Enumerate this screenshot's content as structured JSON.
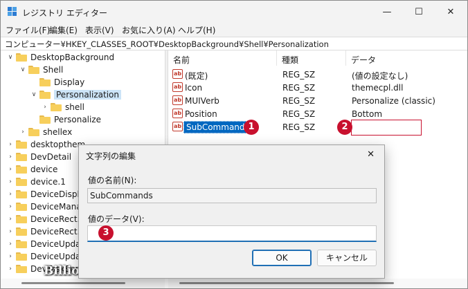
{
  "window": {
    "title": "レジストリ エディター",
    "controls": {
      "minimize": "—",
      "maximize": "☐",
      "close": "✕"
    }
  },
  "menu": [
    "ファイル(F)",
    "編集(E)",
    "表示(V)",
    "お気に入り(A)",
    "ヘルプ(H)"
  ],
  "address": "コンピューター¥HKEY_CLASSES_ROOT¥DesktopBackground¥Shell¥Personalization",
  "tree": [
    {
      "label": "DesktopBackground",
      "arrow": "∨"
    },
    {
      "label": "Shell",
      "arrow": "∨"
    },
    {
      "label": "Display",
      "arrow": ""
    },
    {
      "label": "Personalization",
      "arrow": "∨",
      "selected": true
    },
    {
      "label": "shell",
      "arrow": "›"
    },
    {
      "label": "Personalize",
      "arrow": ""
    },
    {
      "label": "shellex",
      "arrow": "›"
    },
    {
      "label": "desktopthem…",
      "arrow": "›"
    },
    {
      "label": "DevDetail",
      "arrow": "›"
    },
    {
      "label": "device",
      "arrow": "›"
    },
    {
      "label": "device.1",
      "arrow": "›"
    },
    {
      "label": "DeviceDispla…",
      "arrow": "›"
    },
    {
      "label": "DeviceManag…",
      "arrow": "›"
    },
    {
      "label": "DeviceRect.D…",
      "arrow": "›"
    },
    {
      "label": "DeviceRect.D…",
      "arrow": "›"
    },
    {
      "label": "DeviceUpdat…",
      "arrow": "›"
    },
    {
      "label": "DeviceUpdat…",
      "arrow": "›"
    },
    {
      "label": "DevTaskSer…",
      "arrow": "›"
    }
  ],
  "list": {
    "headers": {
      "name": "名前",
      "type": "種類",
      "data": "データ"
    },
    "rows": [
      {
        "name": "(既定)",
        "type": "REG_SZ",
        "data": "(値の設定なし)"
      },
      {
        "name": "Icon",
        "type": "REG_SZ",
        "data": "themecpl.dll"
      },
      {
        "name": "MUIVerb",
        "type": "REG_SZ",
        "data": "Personalize (classic)"
      },
      {
        "name": "Position",
        "type": "REG_SZ",
        "data": "Bottom"
      },
      {
        "name": "SubCommands",
        "type": "REG_SZ",
        "data": "",
        "selected": true
      }
    ],
    "icon_label": "ab"
  },
  "badges": {
    "one": "1",
    "two": "2",
    "three": "3"
  },
  "dialog": {
    "title": "文字列の編集",
    "close": "✕",
    "name_label": "値の名前(N):",
    "name_value": "SubCommands",
    "data_label": "値のデータ(V):",
    "data_value": "",
    "ok": "OK",
    "cancel": "キャンセル"
  },
  "watermark": "BillionWallet.com",
  "colors": {
    "accent": "#1f6fb5",
    "badge": "#c8102e",
    "selection": "#cce4f7",
    "folder": "#f7cf5c"
  }
}
